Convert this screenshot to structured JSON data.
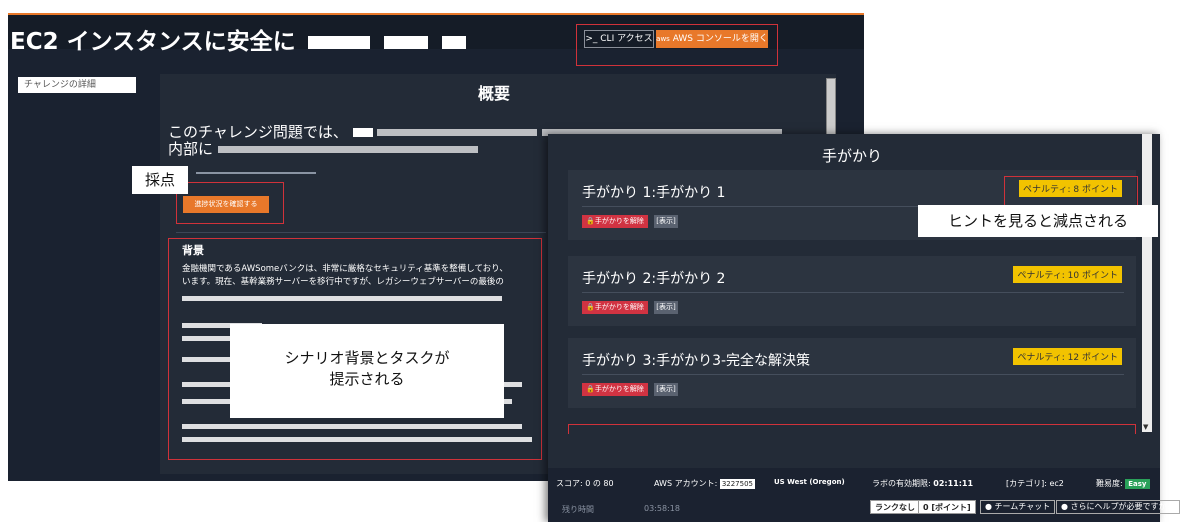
{
  "header": {
    "title": "EC2 インスタンスに安全に",
    "cli_button": "CLI アクセス",
    "aws_button": "AWS コンソールを開く",
    "cli_prefix": ">_",
    "aws_prefix": "aws"
  },
  "sidebar": {
    "challenge_detail": "チャレンジの詳細"
  },
  "overview": {
    "title": "概要",
    "description_line1": "このチャレンジ問題では、",
    "description_line2": "内部に"
  },
  "grading": {
    "label": "採点",
    "progress_button": "進捗状況を確認する"
  },
  "background": {
    "title": "背景",
    "line1": "金融機関であるAWSomeバンクは、非常に厳格なセキュリティ基準を整備しており、",
    "line2": "います。現在、基幹業務サーバーを移行中ですが、レガシーウェブサーバーの最後の"
  },
  "annotations": {
    "scenario": "シナリオ背景とタスクが\n提示される",
    "hint_penalty": "ヒントを見ると減点される"
  },
  "hints": {
    "title": "手がかり",
    "items": [
      {
        "title": "手がかり 1:手がかり 1",
        "penalty": "ペナルティ: 8 ポイント",
        "unlock": "手がかりを解除",
        "show": "[表示]"
      },
      {
        "title": "手がかり 2:手がかり 2",
        "penalty": "ペナルティ: 10 ポイント",
        "unlock": "手がかりを解除",
        "show": "[表示]"
      },
      {
        "title": "手がかり 3:手がかり3-完全な解決策",
        "penalty": "ペナルティ: 12 ポイント",
        "unlock": "手がかりを解除",
        "show": "[表示]"
      }
    ]
  },
  "status": {
    "score": "スコア: 0 の 80",
    "account_label": "AWS アカウント:",
    "account_value": "3227505",
    "region": "US West (Oregon)",
    "lab_expiry_label": "ラボの有効期限:",
    "lab_expiry_value": "02:11:11",
    "category": "[カテゴリ]: ec2",
    "difficulty_label": "難易度:",
    "difficulty_value": "Easy",
    "remaining_label": "残り時間",
    "remaining_value": "03:58:18",
    "rank": "ランクなし",
    "points": "0 [ポイント]",
    "team_chat": "チームチャット",
    "help": "さらにヘルプが必要ですか？"
  }
}
